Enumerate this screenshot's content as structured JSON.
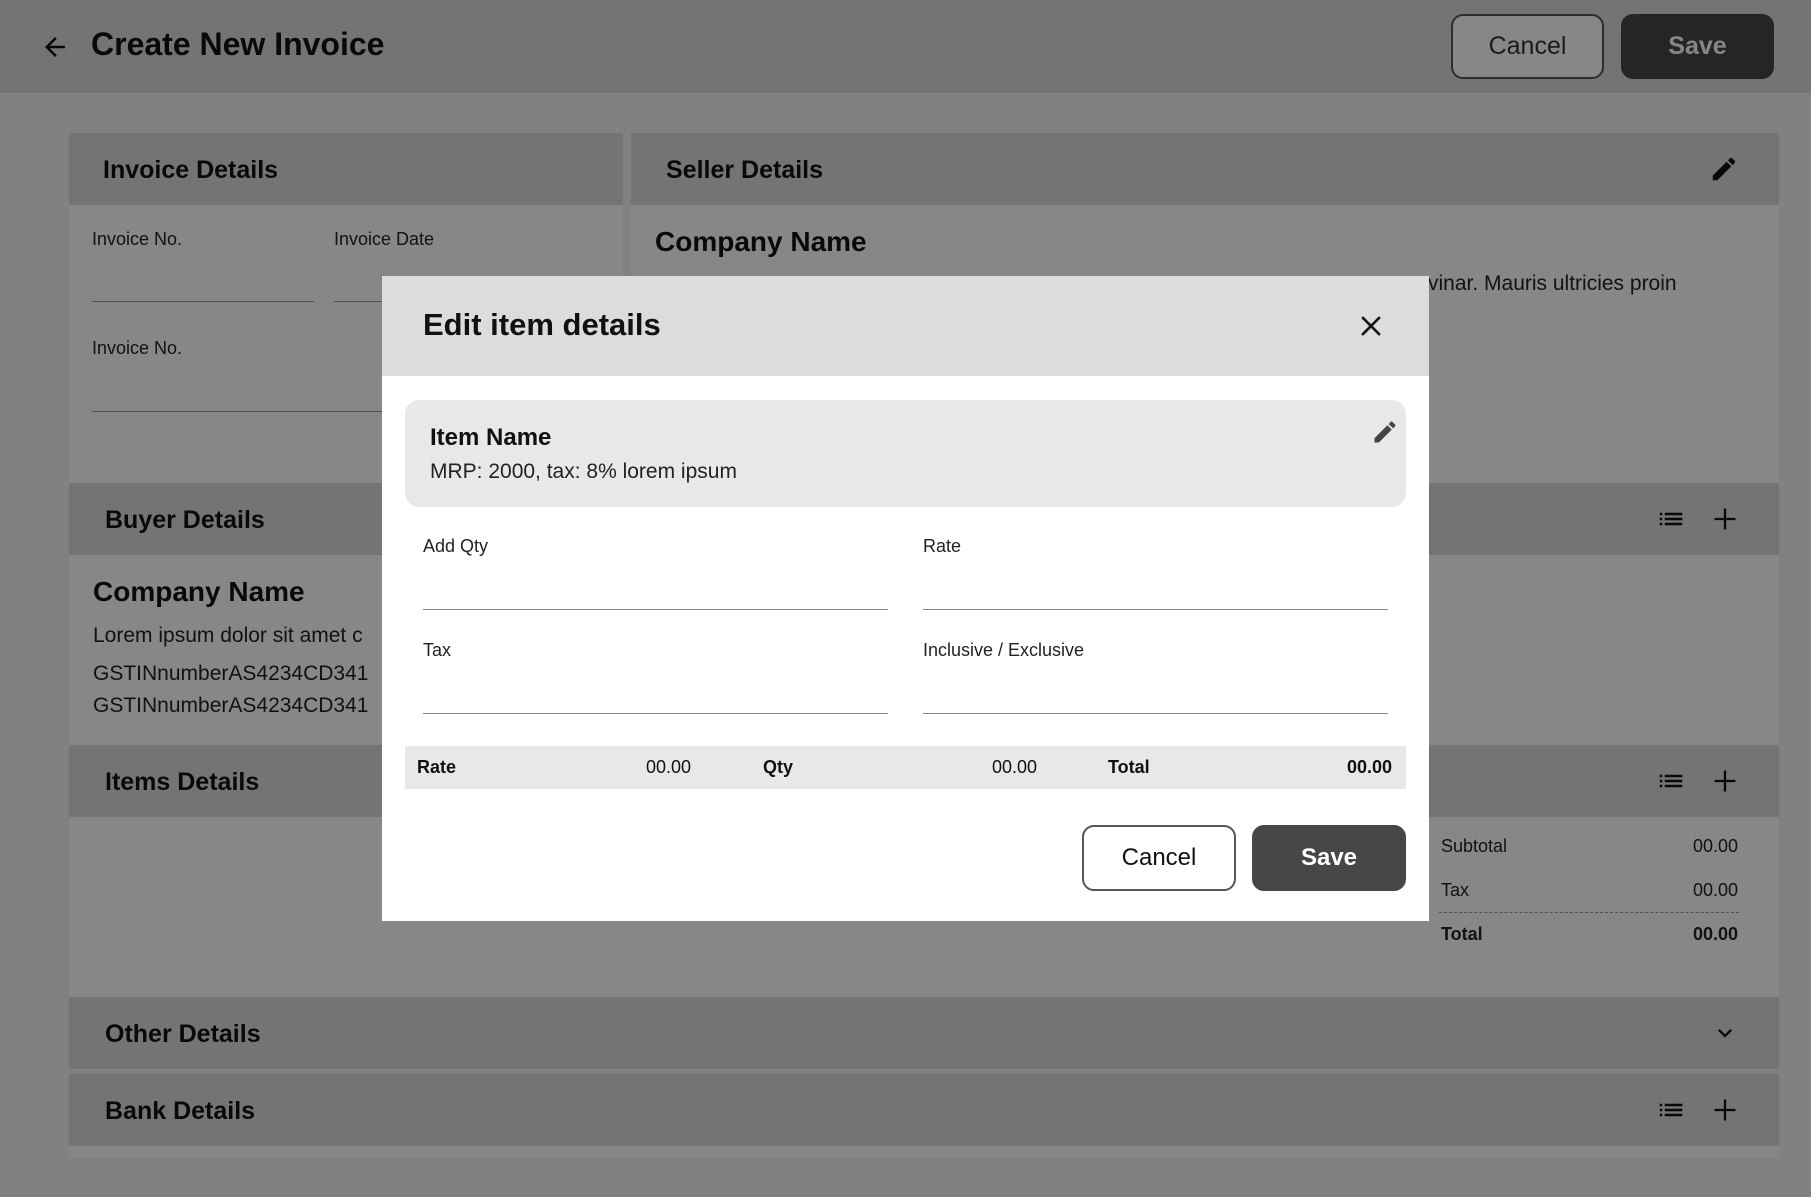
{
  "header": {
    "title": "Create New Invoice",
    "cancel_label": "Cancel",
    "save_label": "Save"
  },
  "invoice_details": {
    "title": "Invoice Details",
    "invoice_no_label": "Invoice No.",
    "invoice_date_label": "Invoice Date",
    "invoice_no2_label": "Invoice No."
  },
  "seller_details": {
    "title": "Seller Details",
    "company_name": "Company Name",
    "address_fragment": "vinar. Mauris ultricies proin"
  },
  "buyer_details": {
    "title": "Buyer Details",
    "company_name": "Company Name",
    "address_fragment": "Lorem ipsum dolor sit amet c",
    "gstin_1": "GSTINnumberAS4234CD341",
    "gstin_2": "GSTINnumberAS4234CD341"
  },
  "items_details": {
    "title": "Items Details",
    "summary": {
      "subtotal_label": "Subtotal",
      "subtotal_value": "00.00",
      "tax_label": "Tax",
      "tax_value": "00.00",
      "total_label": "Total",
      "total_value": "00.00"
    }
  },
  "other_details": {
    "title": "Other Details"
  },
  "bank_details": {
    "title": "Bank Details"
  },
  "modal": {
    "title": "Edit item details",
    "item": {
      "name": "Item Name",
      "description": "MRP: 2000, tax: 8% lorem ipsum"
    },
    "fields": {
      "add_qty_label": "Add Qty",
      "add_qty_value": "",
      "rate_label": "Rate",
      "rate_value": "",
      "tax_label": "Tax",
      "tax_value": "",
      "incl_excl_label": "Inclusive / Exclusive",
      "incl_excl_value": ""
    },
    "calc": {
      "rate_label": "Rate",
      "rate_value": "00.00",
      "qty_label": "Qty",
      "qty_value": "00.00",
      "total_label": "Total",
      "total_value": "00.00"
    },
    "cancel_label": "Cancel",
    "save_label": "Save"
  },
  "icons": {
    "back": "arrow-left-icon",
    "edit": "pencil-icon",
    "list": "list-icon",
    "add": "plus-icon",
    "chevron": "chevron-down-icon",
    "close": "close-icon"
  },
  "colors": {
    "header_bg": "#dcdcdc",
    "primary_button": "#474747",
    "overlay": "rgba(0,0,0,0.47)"
  }
}
